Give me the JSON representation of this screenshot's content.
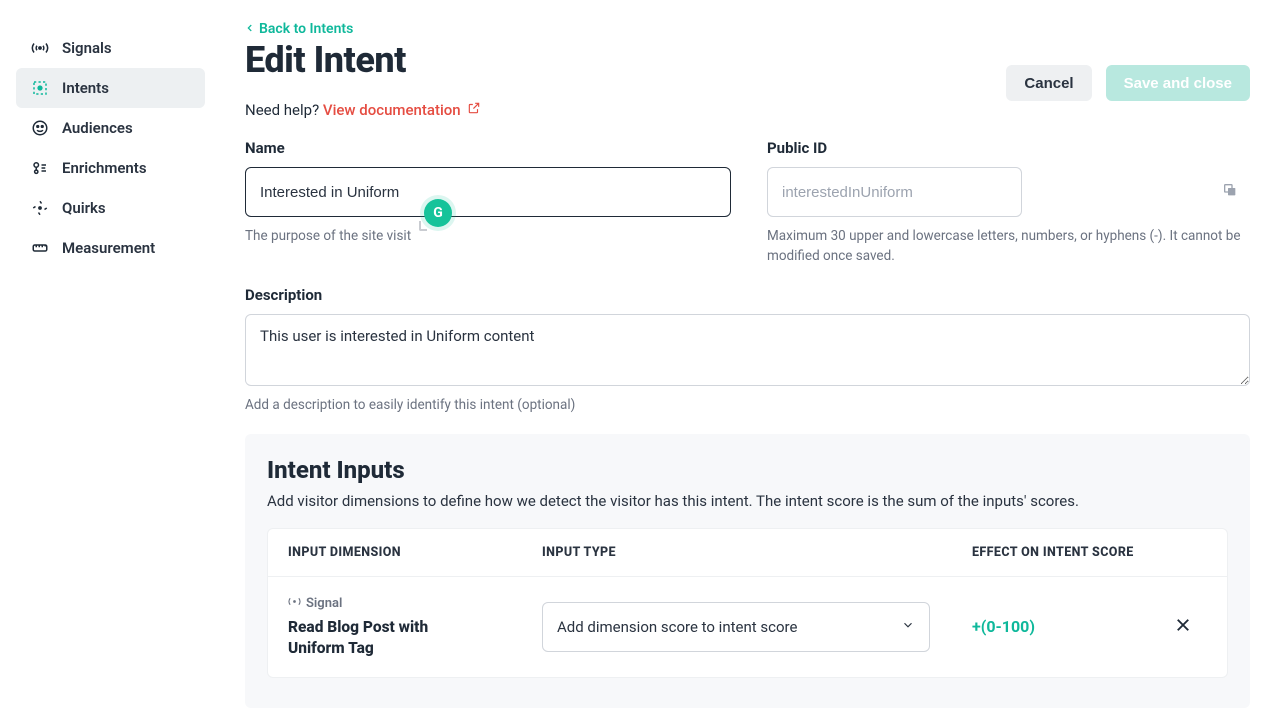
{
  "sidebar": {
    "items": [
      {
        "label": "Signals",
        "active": false
      },
      {
        "label": "Intents",
        "active": true
      },
      {
        "label": "Audiences",
        "active": false
      },
      {
        "label": "Enrichments",
        "active": false
      },
      {
        "label": "Quirks",
        "active": false
      },
      {
        "label": "Measurement",
        "active": false
      }
    ]
  },
  "header": {
    "back_label": "Back to Intents",
    "page_title": "Edit Intent",
    "cancel_label": "Cancel",
    "save_label": "Save and close",
    "help_prefix": "Need help? ",
    "help_link": "View documentation"
  },
  "form": {
    "name_label": "Name",
    "name_value": "Interested in Uniform",
    "name_hint": "The purpose of the site visit",
    "pubid_label": "Public ID",
    "pubid_value": "interestedInUniform",
    "pubid_hint": "Maximum 30 upper and lowercase letters, numbers, or hyphens (-). It cannot be modified once saved.",
    "desc_label": "Description",
    "desc_value": "This user is interested in Uniform content",
    "desc_hint": "Add a description to easily identify this intent (optional)"
  },
  "inputs_panel": {
    "title": "Intent Inputs",
    "description": "Add visitor dimensions to define how we detect the visitor has this intent. The intent score is the sum of the inputs' scores.",
    "columns": {
      "dimension": "INPUT DIMENSION",
      "type": "INPUT TYPE",
      "effect": "EFFECT ON INTENT SCORE"
    },
    "rows": [
      {
        "tag": "Signal",
        "name": "Read Blog Post with Uniform Tag",
        "type_selected": "Add dimension score to intent score",
        "effect": "+(0-100)"
      }
    ]
  }
}
